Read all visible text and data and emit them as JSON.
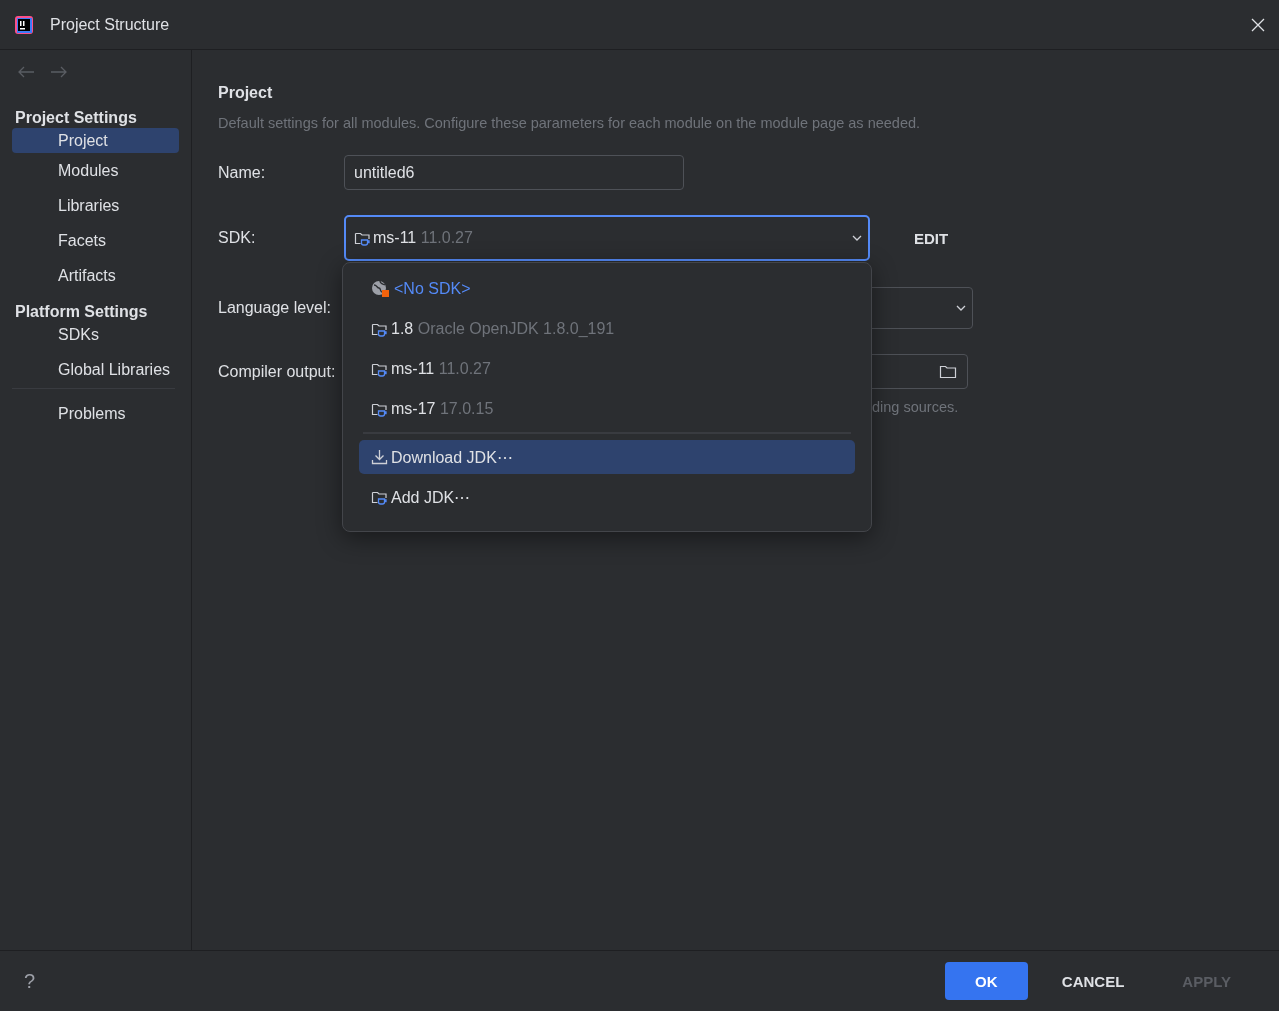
{
  "window": {
    "title": "Project Structure"
  },
  "sidebar": {
    "sections": [
      {
        "title": "Project Settings",
        "items": [
          {
            "label": "Project",
            "selected": true
          },
          {
            "label": "Modules",
            "selected": false
          },
          {
            "label": "Libraries",
            "selected": false
          },
          {
            "label": "Facets",
            "selected": false
          },
          {
            "label": "Artifacts",
            "selected": false
          }
        ]
      },
      {
        "title": "Platform Settings",
        "items": [
          {
            "label": "SDKs",
            "selected": false
          },
          {
            "label": "Global Libraries",
            "selected": false
          }
        ]
      }
    ],
    "footer_items": [
      {
        "label": "Problems",
        "selected": false
      }
    ]
  },
  "content": {
    "title": "Project",
    "description": "Default settings for all modules. Configure these parameters for each module on the module page as needed.",
    "name_label": "Name:",
    "name_value": "untitled6",
    "sdk_label": "SDK:",
    "sdk_name": "ms-11",
    "sdk_version": "11.0.27",
    "edit_button": "EDIT",
    "language_label": "Language level:",
    "compiler_label": "Compiler output:",
    "compiler_hint": "ding sources."
  },
  "sdk_dropdown": {
    "items": [
      {
        "kind": "none",
        "name": "<No SDK>",
        "selected": false
      },
      {
        "kind": "jdk",
        "name": "1.8",
        "version": "Oracle OpenJDK 1.8.0_191",
        "selected": false
      },
      {
        "kind": "jdk",
        "name": "ms-11",
        "version": "11.0.27",
        "selected": false
      },
      {
        "kind": "jdk",
        "name": "ms-17",
        "version": "17.0.15",
        "selected": false
      },
      {
        "kind": "separator"
      },
      {
        "kind": "download",
        "name": "Download JDK⋯",
        "selected": true
      },
      {
        "kind": "add",
        "name": "Add JDK⋯",
        "selected": false
      }
    ]
  },
  "footer": {
    "help": "?",
    "buttons": [
      {
        "label": "OK",
        "kind": "primary",
        "disabled": false
      },
      {
        "label": "CANCEL",
        "kind": "plain",
        "disabled": false
      },
      {
        "label": "APPLY",
        "kind": "plain",
        "disabled": true
      }
    ]
  }
}
